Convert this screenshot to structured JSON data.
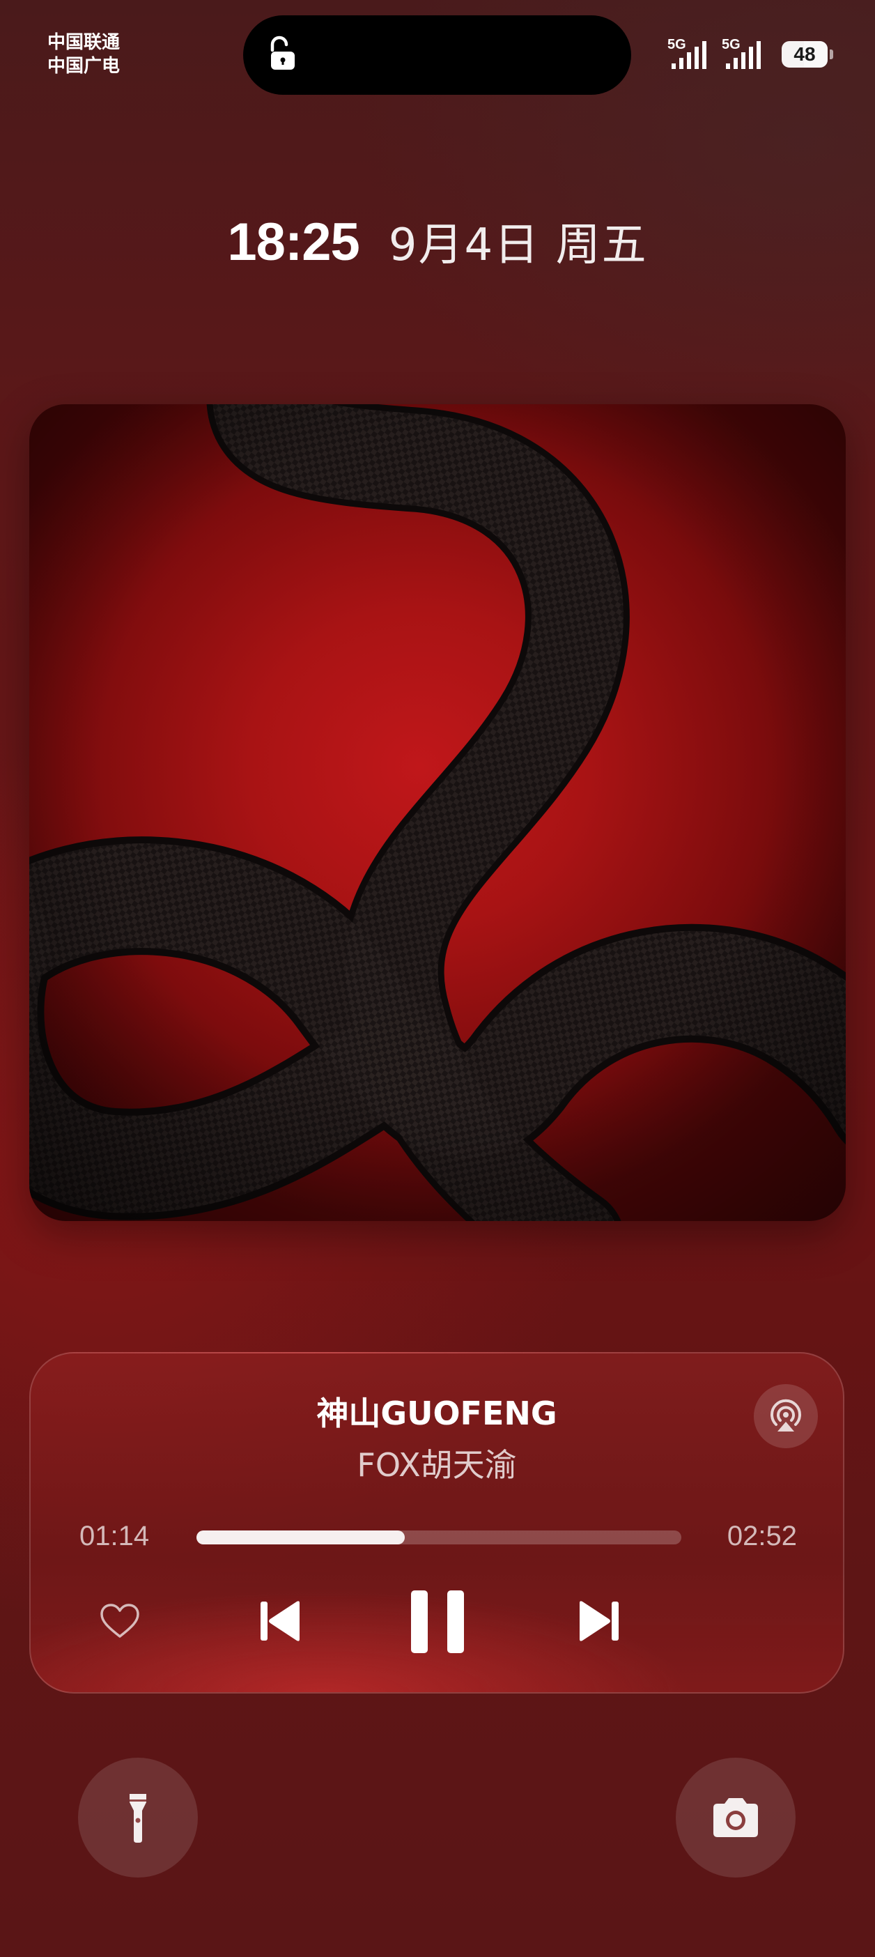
{
  "status_bar": {
    "carrier_1": "中国联通",
    "carrier_2": "中国广电",
    "network_1": "5G",
    "network_2": "5G",
    "battery": "48",
    "battery_level": 0.48
  },
  "clock": {
    "time": "18:25",
    "date": "9月4日 周五"
  },
  "player": {
    "title": "神山GUOFENG",
    "artist": "FOX胡天渝",
    "elapsed": "01:14",
    "duration": "02:52",
    "progress": 0.43
  },
  "colors": {
    "accent": "#c0171a",
    "background": "#5e1718"
  },
  "icons": {
    "lock": "unlocked-padlock-icon",
    "airplay": "airplay-audio-icon",
    "like": "heart-icon",
    "previous": "previous-track-icon",
    "pause": "pause-icon",
    "next": "next-track-icon",
    "flashlight": "flashlight-icon",
    "camera": "camera-icon"
  }
}
